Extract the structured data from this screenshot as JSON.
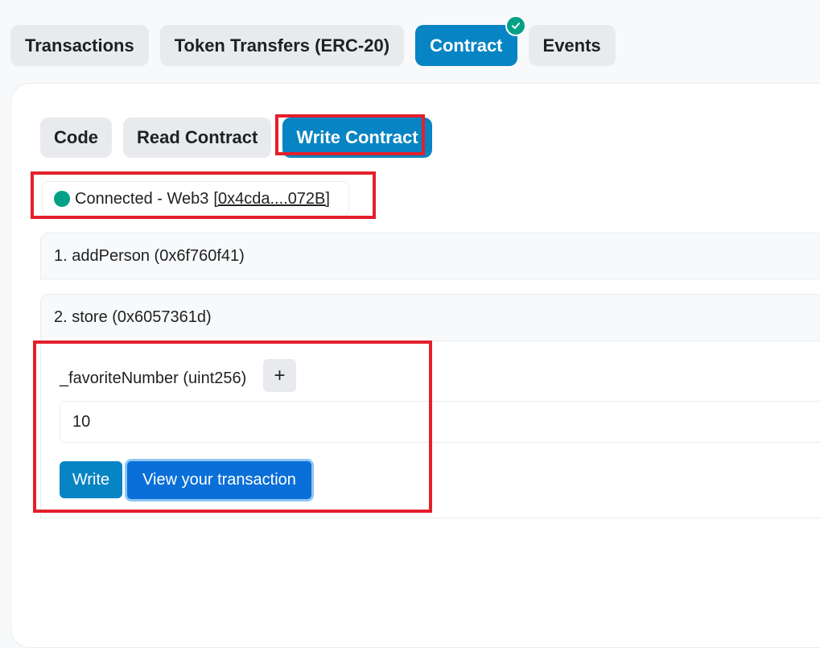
{
  "top_tabs": [
    {
      "label": "Transactions",
      "active": false
    },
    {
      "label": "Token Transfers (ERC-20)",
      "active": false
    },
    {
      "label": "Contract",
      "active": true,
      "verified_badge": "check-icon"
    },
    {
      "label": "Events",
      "active": false
    }
  ],
  "sub_tabs": [
    {
      "label": "Code",
      "active": false
    },
    {
      "label": "Read Contract",
      "active": false
    },
    {
      "label": "Write Contract",
      "active": true
    }
  ],
  "connection": {
    "status_text": "Connected - Web3",
    "address_open": "[",
    "address": "0x4cda....072B",
    "address_close": "]",
    "status_color": "#00a186"
  },
  "functions": [
    {
      "label": "1. addPerson (0x6f760f41)",
      "expanded": false
    },
    {
      "label": "2. store (0x6057361d)",
      "expanded": true
    }
  ],
  "store_form": {
    "param_label": "_favoriteNumber (uint256)",
    "plus_label": "+",
    "value": "10",
    "write_label": "Write",
    "view_tx_label": "View your transaction"
  },
  "colors": {
    "accent": "#0784c3",
    "highlight": "#e3202b",
    "success": "#00a186"
  }
}
